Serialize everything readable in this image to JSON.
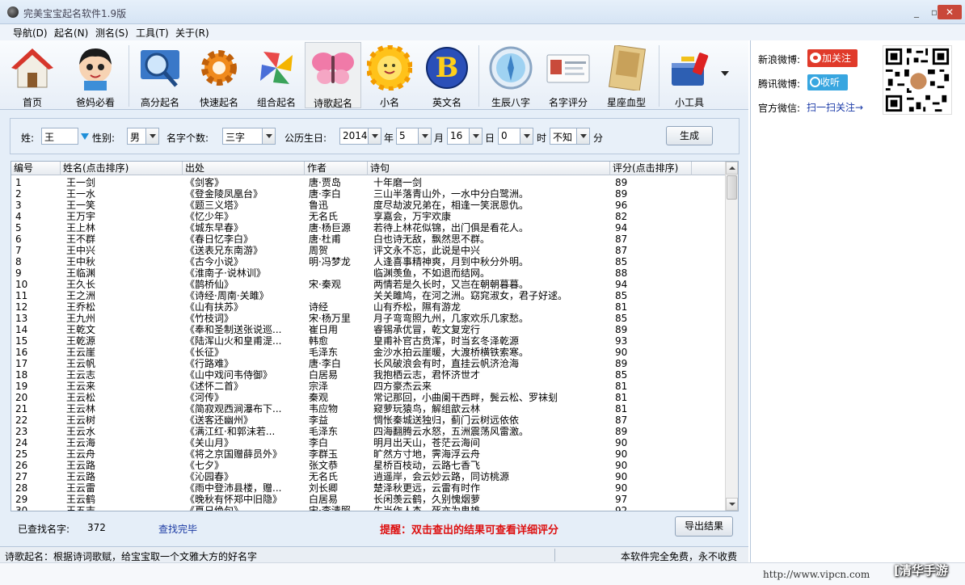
{
  "window": {
    "title": "完美宝宝起名软件1.9版"
  },
  "menu": [
    "导航(D)",
    "起名(N)",
    "测名(S)",
    "工具(T)",
    "关于(R)"
  ],
  "toolbar": [
    {
      "label": "首页",
      "icon": "house-icon"
    },
    {
      "label": "爸妈必看",
      "icon": "baby-icon"
    },
    {
      "label": "高分起名",
      "icon": "magnifier-icon"
    },
    {
      "label": "快速起名",
      "icon": "gear-icon"
    },
    {
      "label": "组合起名",
      "icon": "pinwheel-icon"
    },
    {
      "label": "诗歌起名",
      "icon": "butterfly-icon"
    },
    {
      "label": "小名",
      "icon": "sun-icon"
    },
    {
      "label": "英文名",
      "icon": "letter-b-icon"
    },
    {
      "label": "生辰八字",
      "icon": "compass-icon"
    },
    {
      "label": "名字评分",
      "icon": "id-card-icon"
    },
    {
      "label": "星座血型",
      "icon": "angel-card-icon"
    },
    {
      "label": "小工具",
      "icon": "toolbox-icon"
    }
  ],
  "social": {
    "weibo_label": "新浪微博:",
    "weibo_button": "加关注",
    "tencent_label": "腾讯微博:",
    "tencent_button": "收听",
    "wechat_label": "官方微信:",
    "wechat_link": "扫一扫关注→"
  },
  "form": {
    "surname_label": "姓:",
    "surname_value": "王",
    "gender_label": "性别:",
    "gender_value": "男",
    "count_label": "名字个数:",
    "count_value": "三字",
    "birthday_label": "公历生日:",
    "year_value": "2014",
    "year_unit": "年",
    "month_value": "5",
    "month_unit": "月",
    "day_value": "16",
    "day_unit": "日",
    "hour_value": "0",
    "hour_unit": "时",
    "minute_value": "不知",
    "minute_unit": "分",
    "generate_button": "生成"
  },
  "table": {
    "headers": [
      "编号",
      "姓名(点击排序)",
      "出处",
      "作者",
      "诗句",
      "评分(点击排序)"
    ],
    "rows": [
      [
        "1",
        "王一剑",
        "《剑客》",
        "唐·贾岛",
        "十年磨一剑",
        "89"
      ],
      [
        "2",
        "王一水",
        "《登金陵凤凰台》",
        "唐·李白",
        "三山半落青山外，一水中分白鹭洲。",
        "89"
      ],
      [
        "3",
        "王一笑",
        "《题三义塔》",
        "鲁迅",
        "度尽劫波兄弟在，相逢一笑泯恩仇。",
        "96"
      ],
      [
        "4",
        "王万宇",
        "《忆少年》",
        "无名氏",
        "享嘉会，万宇欢康",
        "82"
      ],
      [
        "5",
        "王上林",
        "《城东早春》",
        "唐·杨巨源",
        "若待上林花似锦，出门俱是看花人。",
        "94"
      ],
      [
        "6",
        "王不群",
        "《春日忆李白》",
        "唐·杜甫",
        "白也诗无敌，飘然思不群。",
        "87"
      ],
      [
        "7",
        "王中兴",
        "《送表兄东南游》",
        "周贺",
        "评文永不忘，此说是中兴",
        "87"
      ],
      [
        "8",
        "王中秋",
        "《古今小说》",
        "明·冯梦龙",
        "人逢喜事精神爽，月到中秋分外明。",
        "85"
      ],
      [
        "9",
        "王临渊",
        "《淮南子·说林训》",
        "",
        "临渊羡鱼，不如退而结网。",
        "88"
      ],
      [
        "10",
        "王久长",
        "《鹊桥仙》",
        "宋·秦观",
        "两情若是久长时，又岂在朝朝暮暮。",
        "94"
      ],
      [
        "11",
        "王之洲",
        "《诗经·周南·关雎》",
        "",
        "关关雎鸠，在河之洲。窈窕淑女，君子好逑。",
        "85"
      ],
      [
        "12",
        "王乔松",
        "《山有扶苏》",
        "诗经",
        "山有乔松，隰有游龙",
        "81"
      ],
      [
        "13",
        "王九州",
        "《竹枝词》",
        "宋·杨万里",
        "月子弯弯照九州，几家欢乐几家愁。",
        "85"
      ],
      [
        "14",
        "王乾文",
        "《奉和圣制送张说巡...",
        "崔日用",
        "睿锡承优冒，乾文复宠行",
        "89"
      ],
      [
        "15",
        "王乾源",
        "《陆浑山火和皇甫湜...",
        "韩愈",
        "皇甫补官古贲浑，时当玄冬泽乾源",
        "93"
      ],
      [
        "16",
        "王云崖",
        "《长征》",
        "毛泽东",
        "金沙水拍云崖暖，大渡桥横铁索寒。",
        "90"
      ],
      [
        "17",
        "王云帆",
        "《行路难》",
        "唐·李白",
        "长风破浪会有时，直挂云帆济沧海",
        "89"
      ],
      [
        "18",
        "王云志",
        "《山中戏问韦侍御》",
        "白居易",
        "我抱栖云志，君怀济世才",
        "85"
      ],
      [
        "19",
        "王云来",
        "《述怀二首》",
        "宗泽",
        "四方豪杰云来",
        "81"
      ],
      [
        "20",
        "王云松",
        "《河传》",
        "秦观",
        "常记那回，小曲阑干西畔，鬓云松、罗袜刬",
        "81"
      ],
      [
        "21",
        "王云林",
        "《简寂观西涧瀑布下...",
        "韦应物",
        "窥萝玩猿鸟，解组歆云林",
        "81"
      ],
      [
        "22",
        "王云树",
        "《送客还幽州》",
        "李益",
        "惆怅秦城送独归，蓟门云树远依依",
        "87"
      ],
      [
        "23",
        "王云水",
        "《满江红·和郭沫若...",
        "毛泽东",
        "四海翻腾云水怒，五洲震荡风雷激。",
        "89"
      ],
      [
        "24",
        "王云海",
        "《关山月》",
        "李白",
        "明月出天山，苍茫云海间",
        "90"
      ],
      [
        "25",
        "王云舟",
        "《将之京国赠薛员外》",
        "李群玉",
        "旷然方寸地，霁海浮云舟",
        "90"
      ],
      [
        "26",
        "王云路",
        "《七夕》",
        "张文恭",
        "星桥百枝动，云路七香飞",
        "90"
      ],
      [
        "27",
        "王云路",
        "《沁园春》",
        "无名氏",
        "逍遥岸，会云妙云路，同访桃源",
        "90"
      ],
      [
        "28",
        "王云雷",
        "《雨中登沛县楼，赠...",
        "刘长卿",
        "楚泽秋更远，云雷有时作",
        "90"
      ],
      [
        "29",
        "王云鹤",
        "《晚秋有怀郑中旧隐》",
        "白居易",
        "长闲羡云鹤，久别愧烟萝",
        "97"
      ],
      [
        "30",
        "王五志",
        "《夏日绝句》",
        "宋·李清照",
        "生当作人杰，死亦为鬼雄。",
        "92"
      ]
    ]
  },
  "results": {
    "found_label": "已查找名字:",
    "found_value": "372",
    "status": "查找完毕",
    "tip": "提醒：双击查出的结果可查看详细评分",
    "export_button": "导出结果"
  },
  "statusbar": {
    "left": "诗歌起名：根据诗词歌赋，给宝宝取一个文雅大方的好名字",
    "right": "本软件完全免费，永不收费"
  },
  "footer": {
    "url": "http://www.vipcn.com",
    "watermark": "[清华手游"
  }
}
